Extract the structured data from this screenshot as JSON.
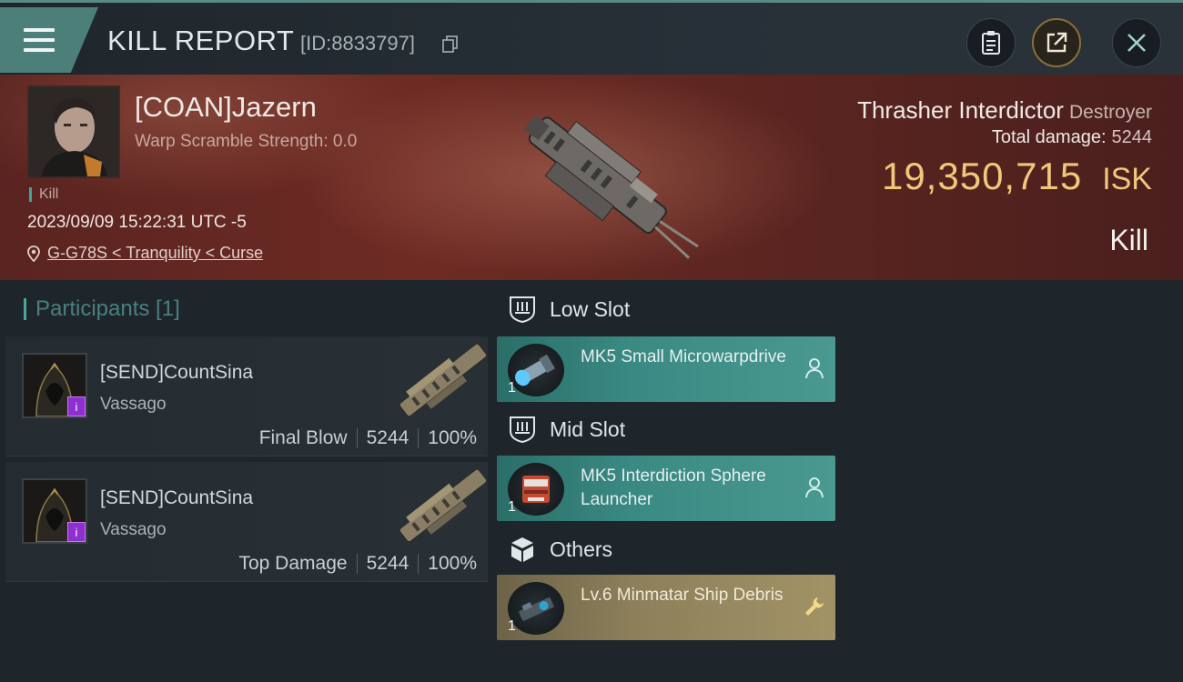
{
  "header": {
    "title": "KILL REPORT",
    "report_id": "[ID:8833797]"
  },
  "victim": {
    "name": "[COAN]Jazern",
    "warp_scramble": "Warp Scramble Strength: 0.0",
    "tag": "Kill",
    "timestamp": "2023/09/09 15:22:31 UTC -5",
    "location": "G-G78S < Tranquility < Curse",
    "ship_name": "Thrasher Interdictor",
    "ship_class": "Destroyer",
    "total_damage_label": "Total damage:",
    "total_damage": "5244",
    "isk_value": "19,350,715",
    "isk_unit": "ISK",
    "outcome": "Kill"
  },
  "participants": {
    "heading": "Participants [1]",
    "rows": [
      {
        "name": "[SEND]CountSina",
        "ship": "Vassago",
        "role": "Final Blow",
        "damage": "5244",
        "percent": "100%",
        "badge": "i"
      },
      {
        "name": "[SEND]CountSina",
        "ship": "Vassago",
        "role": "Top Damage",
        "damage": "5244",
        "percent": "100%",
        "badge": "i"
      }
    ]
  },
  "slots": {
    "low": {
      "label": "Low Slot",
      "items": [
        {
          "qty": "1",
          "name": "MK5 Small Microwarpdrive"
        }
      ]
    },
    "mid": {
      "label": "Mid Slot",
      "items": [
        {
          "qty": "1",
          "name": "MK5 Interdiction Sphere Launcher"
        }
      ]
    },
    "others": {
      "label": "Others",
      "items": [
        {
          "qty": "1",
          "name": "Lv.6 Minmatar Ship Debris"
        }
      ]
    }
  },
  "colors": {
    "accent_teal": "#4d7f7a",
    "isk_gold": "#f2c77a",
    "card_teal": "#3a8a83",
    "card_gold": "#8c7f5a",
    "badge_purple": "#8e2fd0"
  },
  "icons": {
    "menu": "hamburger-icon",
    "copy": "copy-icon",
    "clipboard": "clipboard-icon",
    "share": "share-icon",
    "close": "close-icon",
    "location": "location-pin-icon",
    "low_slot": "low-slot-icon",
    "mid_slot": "mid-slot-icon",
    "others": "cube-icon",
    "pilot": "person-icon",
    "wrench": "wrench-icon"
  }
}
